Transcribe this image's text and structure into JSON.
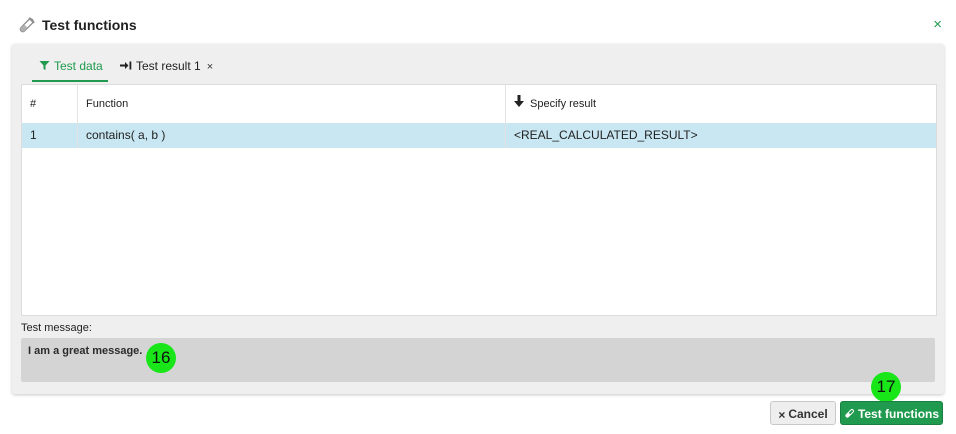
{
  "dialog": {
    "title": "Test functions",
    "close_symbol": "×",
    "header_icon": "test-tube-icon"
  },
  "tabs": [
    {
      "label": "Test data",
      "icon": "filter-icon",
      "active": true
    },
    {
      "label": "Test result 1",
      "icon": "arrow-right-bar-icon",
      "closable": true,
      "close_symbol": "×"
    }
  ],
  "table": {
    "columns": [
      "#",
      "Function",
      "Specify result"
    ],
    "sort_icon": "arrow-down-icon",
    "rows": [
      {
        "num": "1",
        "function": "contains( a, b )",
        "result": "<REAL_CALCULATED_RESULT>"
      }
    ],
    "selected_row_color": "#c8e7f2"
  },
  "message": {
    "label": "Test message:",
    "text": "I am a great message."
  },
  "markers": [
    "16",
    "17"
  ],
  "buttons": {
    "cancel_label": "Cancel",
    "cancel_symbol": "×",
    "test_label": "Test functions"
  },
  "colors": {
    "accent": "#1f9a4e",
    "marker": "#18e618"
  }
}
